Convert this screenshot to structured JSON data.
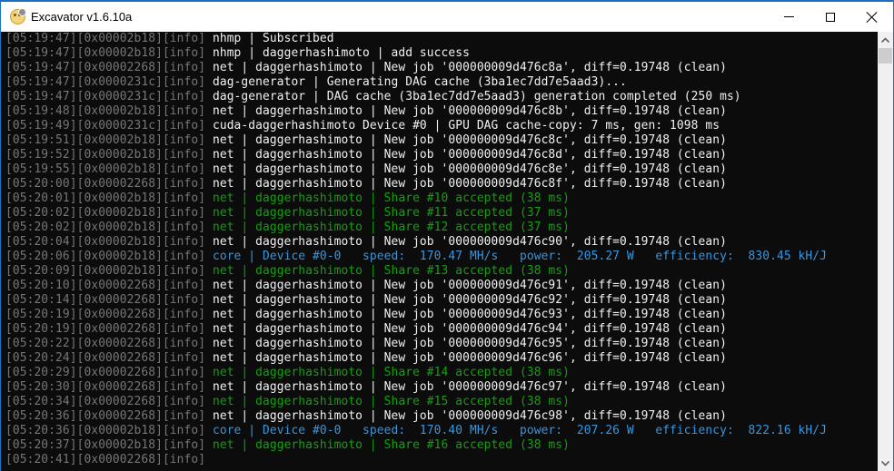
{
  "window": {
    "title": "Excavator v1.6.10a",
    "icon": "excavator-app-icon",
    "controls": {
      "minimize": "minimize-icon",
      "maximize": "maximize-icon",
      "close": "close-icon"
    }
  },
  "colors": {
    "background": "#0c0c0c",
    "prefix": "#767676",
    "default_text": "#f2f2f2",
    "share_accepted": "#13a10e",
    "core_stats": "#3a96dd"
  },
  "console": {
    "lines": [
      {
        "prefix": "[05:19:47][0x00002b18][info]",
        "message": " nhmp | Subscribed",
        "color": "white"
      },
      {
        "prefix": "[05:19:47][0x00002b18][info]",
        "message": " nhmp | daggerhashimoto | add success",
        "color": "white"
      },
      {
        "prefix": "[05:19:47][0x00002268][info]",
        "message": " net | daggerhashimoto | New job '000000009d476c8a', diff=0.19748 (clean)",
        "color": "white"
      },
      {
        "prefix": "[05:19:47][0x0000231c][info]",
        "message": " dag-generator | Generating DAG cache (3ba1ec7dd7e5aad3)...",
        "color": "white"
      },
      {
        "prefix": "[05:19:47][0x0000231c][info]",
        "message": " dag-generator | DAG cache (3ba1ec7dd7e5aad3) generation completed (250 ms)",
        "color": "white"
      },
      {
        "prefix": "[05:19:48][0x00002b18][info]",
        "message": " net | daggerhashimoto | New job '000000009d476c8b', diff=0.19748 (clean)",
        "color": "white"
      },
      {
        "prefix": "[05:19:49][0x0000231c][info]",
        "message": " cuda-daggerhashimoto Device #0 | GPU DAG cache-copy: 7 ms, gen: 1098 ms",
        "color": "white"
      },
      {
        "prefix": "[05:19:51][0x00002b18][info]",
        "message": " net | daggerhashimoto | New job '000000009d476c8c', diff=0.19748 (clean)",
        "color": "white"
      },
      {
        "prefix": "[05:19:52][0x00002b18][info]",
        "message": " net | daggerhashimoto | New job '000000009d476c8d', diff=0.19748 (clean)",
        "color": "white"
      },
      {
        "prefix": "[05:19:55][0x00002b18][info]",
        "message": " net | daggerhashimoto | New job '000000009d476c8e', diff=0.19748 (clean)",
        "color": "white"
      },
      {
        "prefix": "[05:20:00][0x00002268][info]",
        "message": " net | daggerhashimoto | New job '000000009d476c8f', diff=0.19748 (clean)",
        "color": "white"
      },
      {
        "prefix": "[05:20:01][0x00002b18][info]",
        "message": " net | daggerhashimoto | Share #10 accepted (38 ms)",
        "color": "green"
      },
      {
        "prefix": "[05:20:02][0x00002b18][info]",
        "message": " net | daggerhashimoto | Share #11 accepted (37 ms)",
        "color": "green"
      },
      {
        "prefix": "[05:20:02][0x00002b18][info]",
        "message": " net | daggerhashimoto | Share #12 accepted (37 ms)",
        "color": "green"
      },
      {
        "prefix": "[05:20:04][0x00002b18][info]",
        "message": " net | daggerhashimoto | New job '000000009d476c90', diff=0.19748 (clean)",
        "color": "white"
      },
      {
        "prefix": "[05:20:06][0x00002b18][info]",
        "message": " core | Device #0-0   speed:  170.47 MH/s   power:  205.27 W   efficiency:  830.45 kH/J",
        "color": "cyan"
      },
      {
        "prefix": "[05:20:09][0x00002b18][info]",
        "message": " net | daggerhashimoto | Share #13 accepted (38 ms)",
        "color": "green"
      },
      {
        "prefix": "[05:20:10][0x00002268][info]",
        "message": " net | daggerhashimoto | New job '000000009d476c91', diff=0.19748 (clean)",
        "color": "white"
      },
      {
        "prefix": "[05:20:14][0x00002268][info]",
        "message": " net | daggerhashimoto | New job '000000009d476c92', diff=0.19748 (clean)",
        "color": "white"
      },
      {
        "prefix": "[05:20:19][0x00002268][info]",
        "message": " net | daggerhashimoto | New job '000000009d476c93', diff=0.19748 (clean)",
        "color": "white"
      },
      {
        "prefix": "[05:20:19][0x00002268][info]",
        "message": " net | daggerhashimoto | New job '000000009d476c94', diff=0.19748 (clean)",
        "color": "white"
      },
      {
        "prefix": "[05:20:22][0x00002268][info]",
        "message": " net | daggerhashimoto | New job '000000009d476c95', diff=0.19748 (clean)",
        "color": "white"
      },
      {
        "prefix": "[05:20:24][0x00002268][info]",
        "message": " net | daggerhashimoto | New job '000000009d476c96', diff=0.19748 (clean)",
        "color": "white"
      },
      {
        "prefix": "[05:20:29][0x00002268][info]",
        "message": " net | daggerhashimoto | Share #14 accepted (38 ms)",
        "color": "green"
      },
      {
        "prefix": "[05:20:30][0x00002268][info]",
        "message": " net | daggerhashimoto | New job '000000009d476c97', diff=0.19748 (clean)",
        "color": "white"
      },
      {
        "prefix": "[05:20:34][0x00002268][info]",
        "message": " net | daggerhashimoto | Share #15 accepted (38 ms)",
        "color": "green"
      },
      {
        "prefix": "[05:20:36][0x00002268][info]",
        "message": " net | daggerhashimoto | New job '000000009d476c98', diff=0.19748 (clean)",
        "color": "white"
      },
      {
        "prefix": "[05:20:36][0x00002b18][info]",
        "message": " core | Device #0-0   speed:  170.40 MH/s   power:  207.26 W   efficiency:  822.16 kH/J",
        "color": "cyan"
      },
      {
        "prefix": "[05:20:37][0x00002b18][info]",
        "message": " net | daggerhashimoto | Share #16 accepted (38 ms)",
        "color": "green"
      },
      {
        "prefix": "[05:20:41][0x00002268][info]",
        "message": "",
        "color": "white"
      }
    ]
  },
  "scrollbar": {
    "up_icon": "chevron-up-icon",
    "down_icon": "chevron-down-icon"
  }
}
